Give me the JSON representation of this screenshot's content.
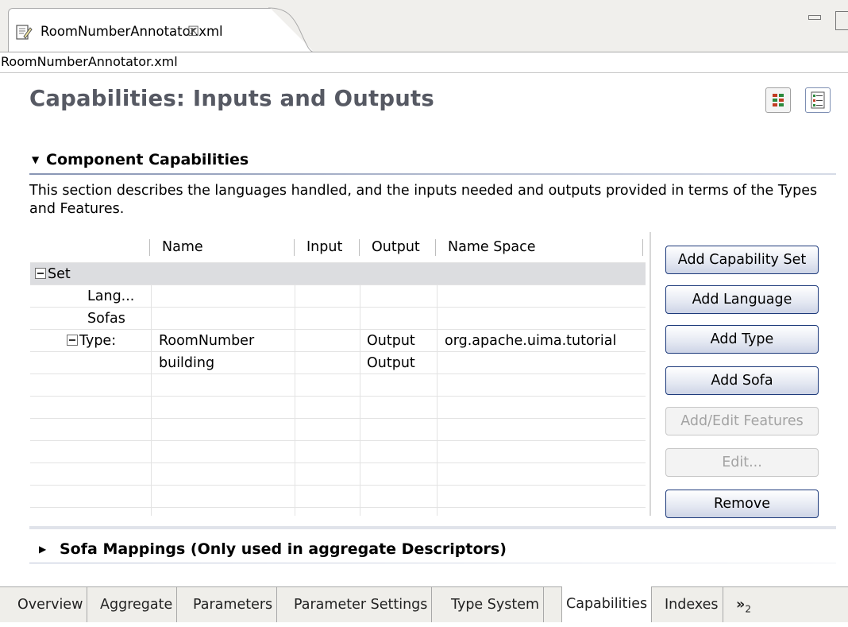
{
  "editor": {
    "tab_title": "RoomNumberAnnotator.xml",
    "tab_close_icon": "close-icon",
    "file_label": "RoomNumberAnnotator.xml"
  },
  "page": {
    "title": "Capabilities: Inputs and Outputs"
  },
  "section": {
    "title": "Component Capabilities",
    "description": "This section describes the languages handled, and the inputs needed and outputs provided in terms of the Types and Features."
  },
  "table": {
    "columns": [
      "",
      "Name",
      "Input",
      "Output",
      "Name Space"
    ],
    "rows": [
      {
        "label": "Set",
        "name": "",
        "input": "",
        "output": "",
        "namespace": "",
        "expander": true
      },
      {
        "label": "Lang...",
        "name": "",
        "input": "",
        "output": "",
        "namespace": ""
      },
      {
        "label": "Sofas",
        "name": "",
        "input": "",
        "output": "",
        "namespace": ""
      },
      {
        "label": "Type:",
        "name": "RoomNumber",
        "input": "",
        "output": "Output",
        "namespace": "org.apache.uima.tutorial",
        "expander": true
      },
      {
        "label": "",
        "name": "building",
        "input": "",
        "output": "Output",
        "namespace": ""
      }
    ]
  },
  "buttons": {
    "add_capability_set": "Add Capability Set",
    "add_language": "Add Language",
    "add_type": "Add Type",
    "add_sofa": "Add Sofa",
    "add_edit_features": "Add/Edit Features",
    "edit": "Edit...",
    "remove": "Remove"
  },
  "section2": {
    "title": "Sofa Mappings (Only used in aggregate Descriptors)"
  },
  "page_tabs": {
    "items": [
      "Overview",
      "Aggregate",
      "Parameters",
      "Parameter Settings",
      "Type System",
      "Capabilities",
      "Indexes"
    ],
    "active": "Capabilities",
    "more_label": "»",
    "more_count": "2"
  }
}
